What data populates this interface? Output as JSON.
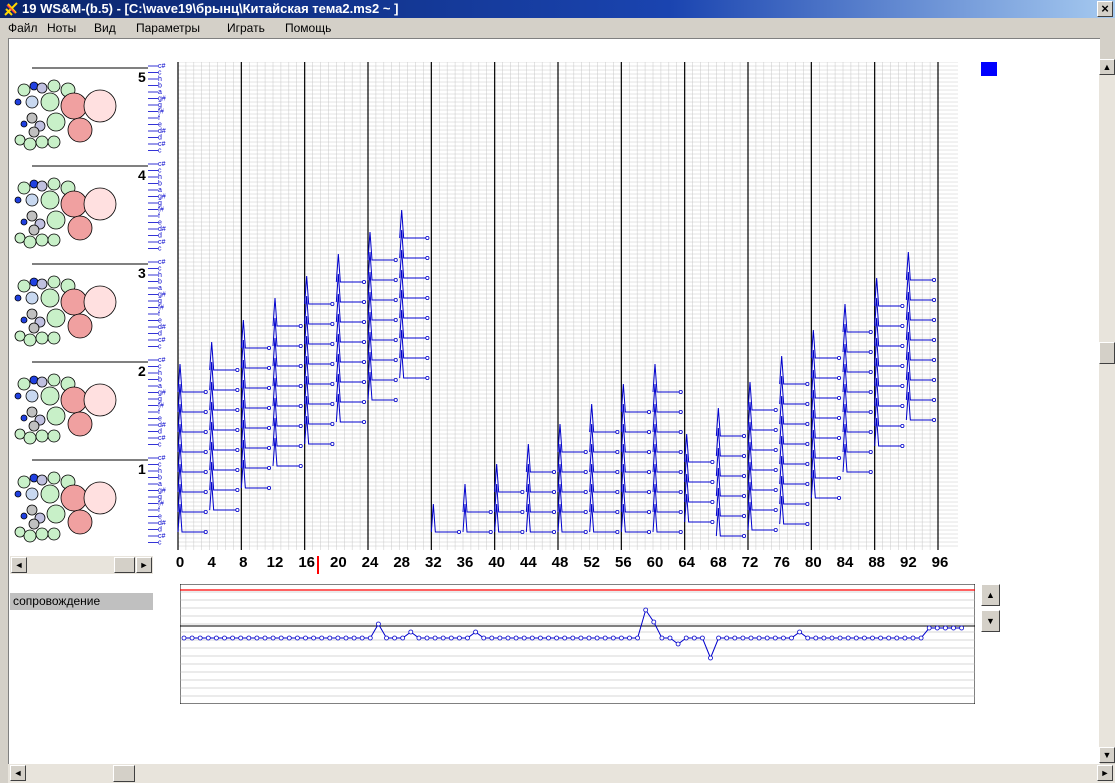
{
  "window": {
    "title": "19 WS&M-(b.5) - [C:\\wave19\\брынц\\Китайская тема2.ms2 ~ ]",
    "close_glyph": "×"
  },
  "menu": [
    "Файл",
    "Ноты",
    "Вид",
    "Параметры",
    "Играть",
    "Помощь"
  ],
  "voices": {
    "numbers": [
      "5",
      "4",
      "3",
      "2",
      "1"
    ]
  },
  "staff": {
    "note_names_top_to_bottom": [
      "c#",
      "c",
      "h",
      "b",
      "a",
      "g#",
      "g",
      "f#",
      "f",
      "e",
      "d#",
      "d",
      "c#",
      "c"
    ]
  },
  "timeline": {
    "ticks": [
      "0",
      "4",
      "8",
      "12",
      "16",
      "20",
      "24",
      "28",
      "32",
      "36",
      "40",
      "44",
      "48",
      "52",
      "56",
      "60",
      "64",
      "68",
      "72",
      "76",
      "80",
      "84",
      "88",
      "92",
      "96"
    ],
    "cursor_beat": 18
  },
  "accompaniment": {
    "label": "сопровождение"
  },
  "scroll": {
    "up_glyph": "▲",
    "down_glyph": "▼",
    "left_glyph": "◄",
    "right_glyph": "►"
  },
  "colors": {
    "notes": "#0000cc",
    "cursor": "#ff0000",
    "grid": "#c8c8c8",
    "bar": "#000000",
    "titlebar": "#0a246a"
  }
}
